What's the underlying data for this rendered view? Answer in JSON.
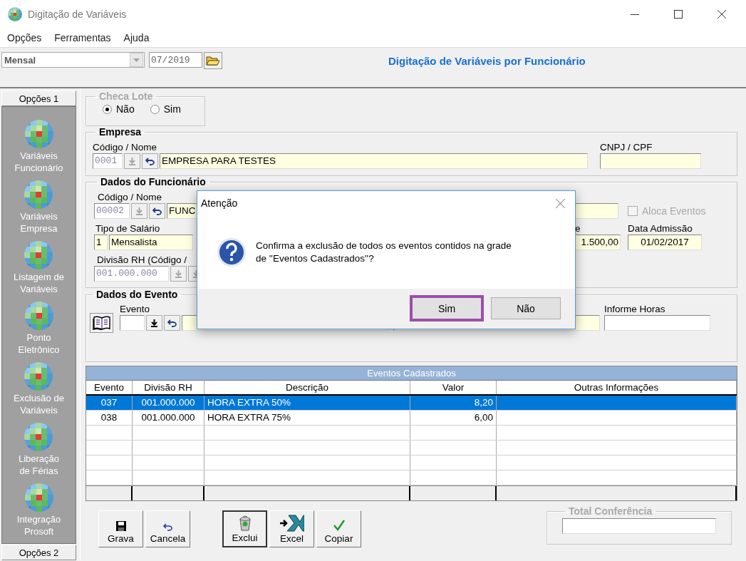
{
  "window": {
    "title": "Digitação de Variáveis"
  },
  "menu": [
    "Opções",
    "Ferramentas",
    "Ajuda"
  ],
  "toolbar": {
    "period": "Mensal",
    "date": "07/2019",
    "heading": "Digitação de Variáveis por Funcionário"
  },
  "sidebar": {
    "header": "Opções 1",
    "items": [
      {
        "label": "Variáveis\nFuncionário"
      },
      {
        "label": "Variáveis\nEmpresa"
      },
      {
        "label": "Listagem de\nVariáveis"
      },
      {
        "label": "Ponto\nEletrônico"
      },
      {
        "label": "Exclusão de\nVariáveis"
      },
      {
        "label": "Liberação\nde Férias"
      },
      {
        "label": "Integração\nProsoft"
      }
    ],
    "footer": "Opções 2"
  },
  "checa_lote": {
    "title": "Checa Lote",
    "disabled": true,
    "options": [
      {
        "label": "Não",
        "selected": true
      },
      {
        "label": "Sim",
        "selected": false
      }
    ]
  },
  "empresa": {
    "title": "Empresa",
    "code_label": "Código / Nome",
    "code": "0001",
    "name": "EMPRESA PARA TESTES",
    "cnpj_label": "CNPJ / CPF"
  },
  "funcionario": {
    "title": "Dados do Funcionário",
    "code_label": "Código / Nome",
    "code": "00002",
    "name": "FUNC",
    "aloca": {
      "label": "Aloca Eventos",
      "checked": false,
      "disabled": true
    },
    "salary_type_label": "Tipo de Salário",
    "salary_type_code": "1",
    "salary_type": "Mensalista",
    "salary_label": "e",
    "salary": "1.500,00",
    "admission_label": "Data Admissão",
    "admission": "01/02/2017",
    "division_label": "Divisão RH (Código / ",
    "division": "001.000.000"
  },
  "evento": {
    "title": "Dados do Evento",
    "event_label": "Evento",
    "hours_label": "Informe Horas"
  },
  "grid": {
    "title": "Eventos Cadastrados",
    "columns": [
      "Evento",
      "Divisão RH",
      "Descrição",
      "Valor",
      "Outras Informações"
    ],
    "rows": [
      {
        "selected": true,
        "cells": [
          "037",
          "001.000.000",
          "HORA EXTRA 50%",
          "8,20",
          ""
        ]
      },
      {
        "selected": false,
        "cells": [
          "038",
          "001.000.000",
          "HORA EXTRA 75%",
          "6,00",
          ""
        ]
      }
    ]
  },
  "buttons": [
    {
      "label": "Grava",
      "kind": "save",
      "pressed": false
    },
    {
      "label": "Cancela",
      "kind": "undo",
      "pressed": false
    },
    {
      "label": "Exclui",
      "kind": "delete",
      "pressed": true
    },
    {
      "label": "Excel",
      "kind": "excel",
      "pressed": false
    },
    {
      "label": "Copiar",
      "kind": "check",
      "pressed": false
    }
  ],
  "total": {
    "title": "Total Conferência"
  },
  "dialog": {
    "title": "Atenção",
    "message": "Confirma a exclusão de todos os eventos contidos na grade\nde ''Eventos Cadastrados''?",
    "buttons": [
      {
        "label": "Sim",
        "selected": true
      },
      {
        "label": "Não",
        "selected": false
      }
    ]
  }
}
